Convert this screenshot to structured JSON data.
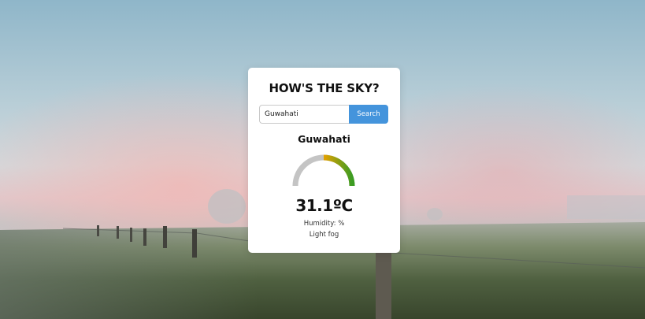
{
  "app": {
    "title": "HOW'S THE SKY?"
  },
  "search": {
    "value": "Guwahati",
    "button_label": "Search"
  },
  "weather": {
    "city": "Guwahati",
    "temperature": "31.1ºC",
    "humidity_label": "Humidity: %",
    "condition": "Light fog",
    "gauge_level": 0.45
  },
  "colors": {
    "accent": "#4494dc",
    "gauge_track": "#c4c4c4",
    "gauge_start": "#e6a100",
    "gauge_end": "#3b9c22"
  },
  "icons": {
    "background": "foggy-field-background"
  }
}
